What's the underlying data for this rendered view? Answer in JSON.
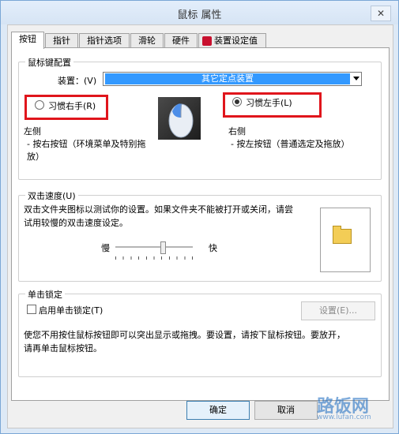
{
  "window": {
    "title": "鼠标 属性",
    "close_icon": "✕"
  },
  "tabs": [
    "按钮",
    "指针",
    "指针选项",
    "滑轮",
    "硬件",
    "装置设定值"
  ],
  "buttons_config": {
    "group_label": "鼠标键配置",
    "device_label": "装置：(V)",
    "device_value": "其它定点装置",
    "right_hand_label": "习惯右手(R)",
    "left_hand_label": "习惯左手(L)",
    "left_side_title": "左侧",
    "left_side_desc_1": "- 按右按钮（环境菜单及特别拖",
    "left_side_desc_2": "放）",
    "right_side_title": "右侧",
    "right_side_desc": "- 按左按钮（普通选定及拖放）"
  },
  "double_click": {
    "group_label": "双击速度(U)",
    "desc_1": "双击文件夹图标以测试你的设置。如果文件夹不能被打开或关闭，请尝",
    "desc_2": "试用较慢的双击速度设定。",
    "slow": "慢",
    "fast": "快"
  },
  "click_lock": {
    "group_label": "单击锁定",
    "checkbox_label": "启用单击锁定(T)",
    "settings_button": "设置(E)...",
    "desc_1": "使您不用按住鼠标按钮即可以突出显示或拖拽。要设置，请按下鼠标按钮。要放开，",
    "desc_2": "请再单击鼠标按钮。"
  },
  "footer": {
    "ok": "确定",
    "cancel": "取消"
  },
  "watermark": {
    "text": "路饭网",
    "sub": "www.lufan.com"
  }
}
